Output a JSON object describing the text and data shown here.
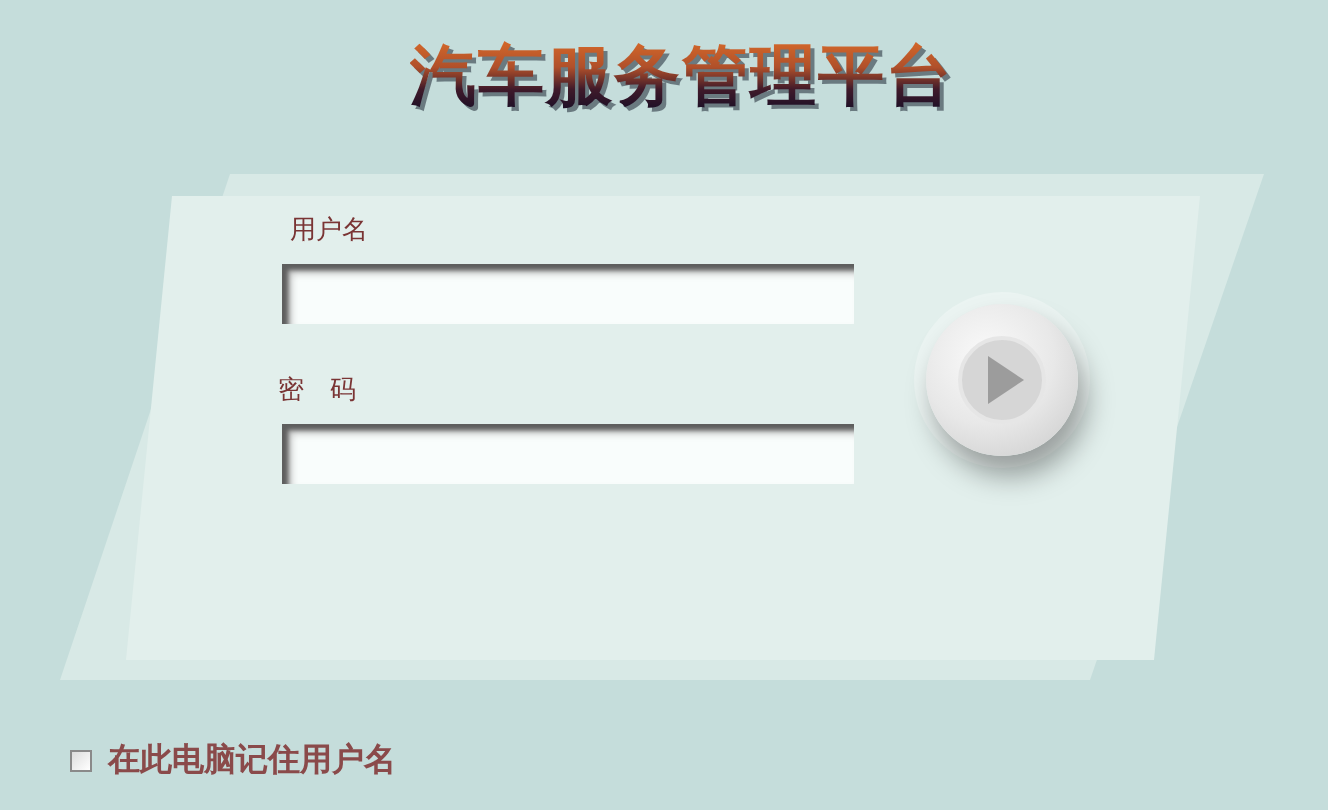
{
  "title": "汽车服务管理平台",
  "fields": [
    {
      "label": "用户名",
      "kind": "text"
    },
    {
      "label": "密　码",
      "kind": "password"
    }
  ],
  "remember": {
    "label": "在此电脑记住用户名",
    "checked": false
  }
}
